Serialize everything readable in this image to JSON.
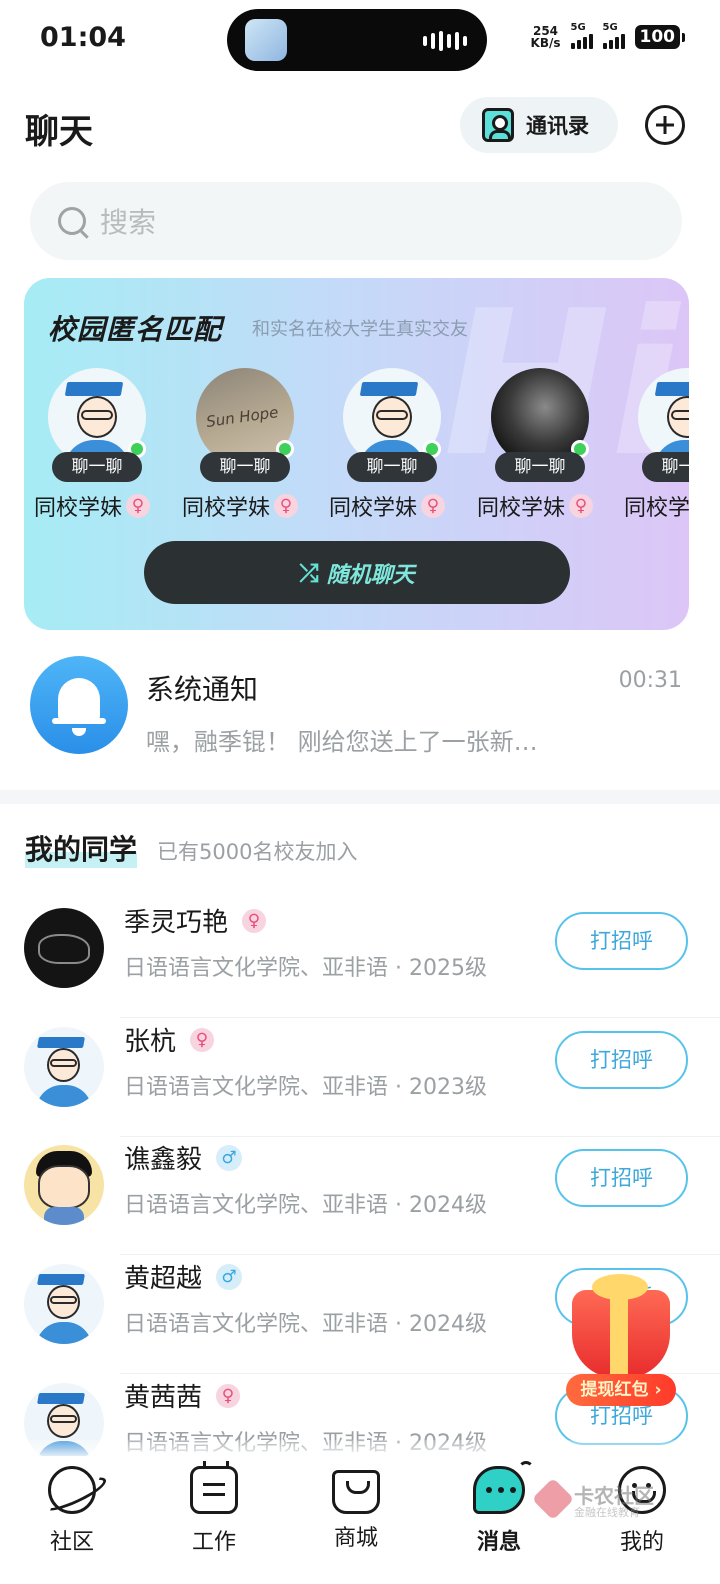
{
  "status_bar": {
    "time": "01:04",
    "net_speed_value": "254",
    "net_speed_unit": "KB/s",
    "signal1": "5G",
    "signal2": "5G",
    "battery": "100"
  },
  "header": {
    "title": "聊天",
    "contacts_label": "通讯录"
  },
  "search": {
    "placeholder": "搜索"
  },
  "campus_match": {
    "title": "校园匿名匹配",
    "subtitle": "和实名在校大学生真实交友",
    "chat_label": "聊一聊",
    "cards": [
      {
        "label": "同校学妹",
        "avatar": "graduate-cartoon",
        "online": true
      },
      {
        "label": "同校学妹",
        "avatar": "sand-writing-photo",
        "online": true
      },
      {
        "label": "同校学妹",
        "avatar": "graduate-cartoon",
        "online": true
      },
      {
        "label": "同校学妹",
        "avatar": "dark-portrait-photo",
        "online": true
      },
      {
        "label": "同校学",
        "avatar": "graduate-cartoon",
        "online": false
      }
    ],
    "random_button": "随机聊天",
    "colors": {
      "gradient_start": "#a6ecf5",
      "gradient_end": "#dcc6f7",
      "button": "#2b3133",
      "button_text": "#7ee6da"
    }
  },
  "system_notice": {
    "title": "系统通知",
    "time": "00:31",
    "message": "嘿，融季锟！ 刚给您送上了一张新…"
  },
  "classmates": {
    "title": "我的同学",
    "subtitle": "已有5000名校友加入",
    "greet_label": "打招呼",
    "items": [
      {
        "name": "季灵巧艳",
        "gender": "female",
        "detail": "日语语言文化学院、亚非语 · 2025级",
        "avatar": "dark-sketch"
      },
      {
        "name": "张杭",
        "gender": "female",
        "detail": "日语语言文化学院、亚非语 · 2023级",
        "avatar": "graduate-cartoon"
      },
      {
        "name": "谯鑫毅",
        "gender": "male",
        "detail": "日语语言文化学院、亚非语 · 2024级",
        "avatar": "crayon-boy-cartoon"
      },
      {
        "name": "黄超越",
        "gender": "male",
        "detail": "日语语言文化学院、亚非语 · 2024级",
        "avatar": "graduate-cartoon"
      },
      {
        "name": "黄茜茜",
        "gender": "female",
        "detail": "日语语言文化学院、亚非语 · 2024级",
        "avatar": "graduate-cartoon"
      }
    ],
    "colors": {
      "female": "#e8507a",
      "male": "#39a7e0",
      "greet_border": "#58c3ea"
    }
  },
  "red_packet": {
    "label": "提现红包 ›"
  },
  "bottom_nav": {
    "items": [
      {
        "label": "社区",
        "icon": "planet-icon"
      },
      {
        "label": "工作",
        "icon": "clipboard-icon"
      },
      {
        "label": "商城",
        "icon": "shopping-bag-icon"
      },
      {
        "label": "消息",
        "icon": "chat-bubble-icon",
        "active": true
      },
      {
        "label": "我的",
        "icon": "smiley-icon"
      }
    ]
  },
  "watermark": {
    "text": "卡农社区",
    "sub": "金融在线教育"
  }
}
